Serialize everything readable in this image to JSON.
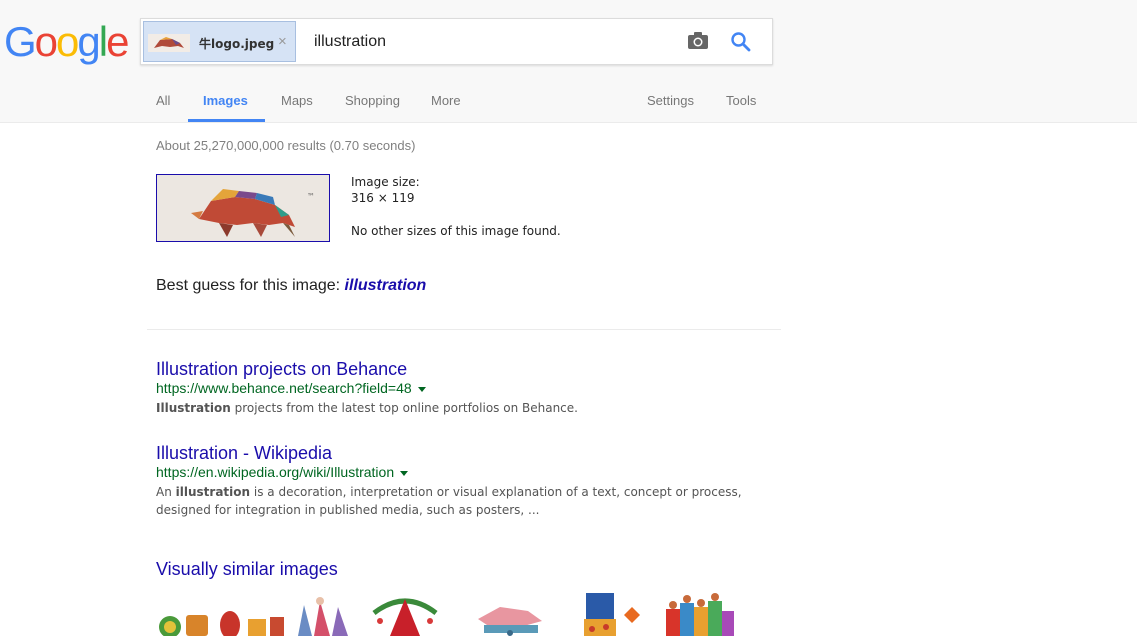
{
  "logo": {
    "letters": [
      "G",
      "o",
      "o",
      "g",
      "l",
      "e"
    ],
    "colors": [
      "#4285f4",
      "#ea4335",
      "#fbbc05",
      "#4285f4",
      "#34a853",
      "#ea4335"
    ]
  },
  "search": {
    "chip_filename": "牛logo.jpeg",
    "chip_remove": "×",
    "query": "illustration"
  },
  "nav": {
    "tabs": [
      "All",
      "Images",
      "Maps",
      "Shopping",
      "More"
    ],
    "active": "Images",
    "settings": "Settings",
    "tools": "Tools"
  },
  "stats": "About 25,270,000,000 results (0.70 seconds)",
  "image_info": {
    "size_label": "Image size:",
    "size_value": "316 × 119",
    "other_sizes": "No other sizes of this image found.",
    "tm_mark": "™"
  },
  "best_guess": {
    "label": "Best guess for this image:",
    "term": "illustration"
  },
  "results": [
    {
      "title": "Illustration projects on Behance",
      "url": "https://www.behance.net/search?field=48",
      "snippet_bold": "Illustration",
      "snippet_rest": " projects from the latest top online portfolios on Behance."
    },
    {
      "title": "Illustration - Wikipedia",
      "url": "https://en.wikipedia.org/wiki/Illustration",
      "snippet_pre": "An ",
      "snippet_bold": "illustration",
      "snippet_rest": " is a decoration, interpretation or visual explanation of a text, concept or process, designed for integration in published media, such as posters, ..."
    }
  ],
  "visually_similar": {
    "title": "Visually similar images"
  },
  "colors": {
    "link": "#1a0dab",
    "url": "#006621",
    "accent": "#4285f4"
  }
}
